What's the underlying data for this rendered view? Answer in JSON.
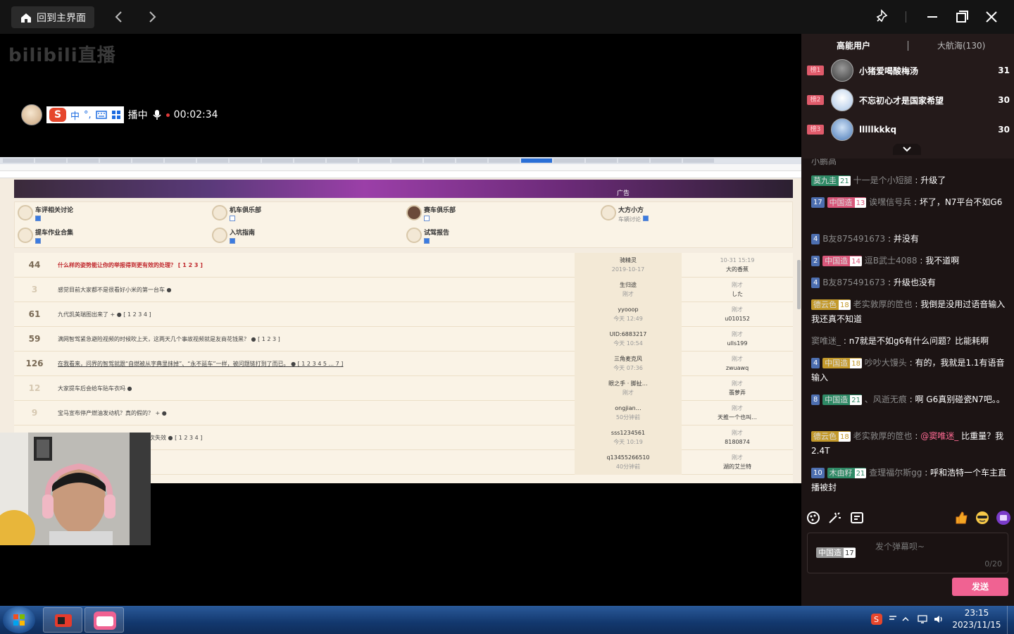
{
  "topbar": {
    "home_label": "回到主界面"
  },
  "stream": {
    "watermark": "bilibili直播",
    "status_text": "播中",
    "timer": "00:02:34",
    "ime": {
      "lang": "中",
      "punct": "°,"
    }
  },
  "forum": {
    "ad_label": "广告",
    "categories": [
      {
        "name": "车评相关讨论",
        "checked": true
      },
      {
        "name": "机车俱乐部",
        "checked": false
      },
      {
        "name": "赛车俱乐部",
        "checked": false
      },
      {
        "name": "大方小方",
        "sub": "车辆讨论",
        "checked": true
      },
      {
        "name": "提车作业合集",
        "checked": true
      },
      {
        "name": "入坑指南",
        "checked": true
      },
      {
        "name": "试驾报告",
        "checked": true
      }
    ],
    "rows": [
      {
        "num": "44",
        "title": "什么样的姿势能让你的举报得到更有效的处理？  [ 1 2 3 ]",
        "red": true,
        "author": "骑精灵",
        "a_time": "2019-10-17",
        "last_time": "10-31 15:19",
        "last_user": "大的香蕉"
      },
      {
        "num": "3",
        "title": "感觉目前大家都不是很看好小米的第一台车 ●",
        "red": false,
        "author": "生归途",
        "a_time": "刚才",
        "last_time": "刚才",
        "last_user": "した"
      },
      {
        "num": "61",
        "title": "九代凯美瑞图出来了 + ●  [ 1 2 3 4 ]",
        "red": false,
        "author": "yyooop",
        "a_time": "今天 12:49",
        "last_time": "刚才",
        "last_user": "u010152"
      },
      {
        "num": "59",
        "title": "满网智驾紧急避险视频的时候吹上天，这两天几个事故视频就是友商花钱黑？ ●  [ 1 2 3 ]",
        "red": false,
        "author": "UID:6883217",
        "a_time": "今天 10:54",
        "last_time": "刚才",
        "last_user": "ulls199"
      },
      {
        "num": "126",
        "title": "在我看来，问界的智驾就跟“自燃被从字典里抹掉”、“永不延车”一样，被问题链打到了而已。 ●  [ 1 2 3 4 5 ... 7 ]",
        "red": false,
        "author": "三角麦克风",
        "a_time": "今天 07:36",
        "last_time": "刚才",
        "last_user": "zwuawq"
      },
      {
        "num": "12",
        "title": "大家提车后会给车贴车衣吗 ●",
        "red": false,
        "author": "眼之手 · 脚扯…",
        "a_time": "刚才",
        "last_time": "刚才",
        "last_user": "翡萝弄"
      },
      {
        "num": "9",
        "title": "宝马宣布停产燃油发动机？真的假的？ + ●",
        "red": false,
        "author": "ongjian…",
        "a_time": "50分钟前",
        "last_time": "刚才",
        "last_user": "天推一个也叫…"
      },
      {
        "num": "",
        "title": "次失效 ●  [ 1 2 3 4 ]",
        "red": false,
        "author": "sss1234561",
        "a_time": "今天 10:19",
        "last_time": "刚才",
        "last_user": "8180874"
      },
      {
        "num": "",
        "title": "",
        "red": false,
        "author": "q13455266510",
        "a_time": "40分钟前",
        "last_time": "刚才",
        "last_user": "湖的艾兰特"
      }
    ]
  },
  "sidebar": {
    "tab_high": "高能用户",
    "tab_fleet": "大航海(130)",
    "ranks": [
      {
        "badge": "榜1",
        "name": "小猪爱喝酸梅汤",
        "score": "31"
      },
      {
        "badge": "榜2",
        "name": "不忘初心才是国家希望",
        "score": "30"
      },
      {
        "badge": "榜3",
        "name": "lllllkkkq",
        "score": "30"
      }
    ],
    "chat": {
      "top_fragment": "小鹏高",
      "messages": [
        {
          "medal": "莫九圭",
          "medal_lv": "21",
          "medal_color": "#2f8a66",
          "user": "十一是个小短腿",
          "text": "升级了"
        },
        {
          "lvl": "17",
          "medal": "中国造",
          "medal_lv": "13",
          "medal_color": "#d9577a",
          "user": "诶嘿信号兵",
          "text": "坏了，N7平台不如G6"
        },
        {
          "lvl": "4",
          "user": "B友875491673",
          "text": "并没有"
        },
        {
          "lvl": "2",
          "medal": "中国造",
          "medal_lv": "14",
          "medal_color": "#d9577a",
          "user": "逗B武士4088",
          "text": "我不道啊"
        },
        {
          "lvl": "4",
          "user": "B友875491673",
          "text": "升级也没有"
        },
        {
          "medal": "德云色",
          "medal_lv": "18",
          "medal_color": "#c49a2c",
          "user": "老实敦厚的笸也",
          "text": "我倒是没用过语音输入我还真不知道"
        },
        {
          "user": "窦唯迷_",
          "text": "n7就是不如g6有什么问题？比能耗啊"
        },
        {
          "lvl": "4",
          "medal": "中国造",
          "medal_lv": "18",
          "medal_color": "#c49a2c",
          "user": "吵吵大馒头",
          "text": "有的，我就是1.1有语音输入"
        },
        {
          "lvl": "8",
          "medal": "中国造",
          "medal_lv": "21",
          "medal_color": "#2f8a66",
          "user": "、风逝无痕",
          "text": "啊 G6真别碰瓷N7吧。。"
        },
        {
          "medal": "德云色",
          "medal_lv": "18",
          "medal_color": "#c49a2c",
          "user": "老实敦厚的笸也",
          "mention": "@窦唯迷_",
          "text": "比重量？我2.4T"
        },
        {
          "lvl": "10",
          "medal": "木由籽",
          "medal_lv": "21",
          "medal_color": "#2f8a66",
          "user": "查理福尔斯gg",
          "text": "呼和浩特一个车主直播被封"
        }
      ]
    },
    "input": {
      "medal": "中国造",
      "medal_lv": "17",
      "placeholder": "发个弹幕呗~",
      "counter": "0/20"
    },
    "send_label": "发送"
  },
  "taskbar": {
    "time": "23:15",
    "date": "2023/11/15"
  },
  "colors": {
    "accent_pink": "#f06292",
    "rank_badge": "#e05b6b",
    "lvl_blue": "#4d6fb0"
  }
}
